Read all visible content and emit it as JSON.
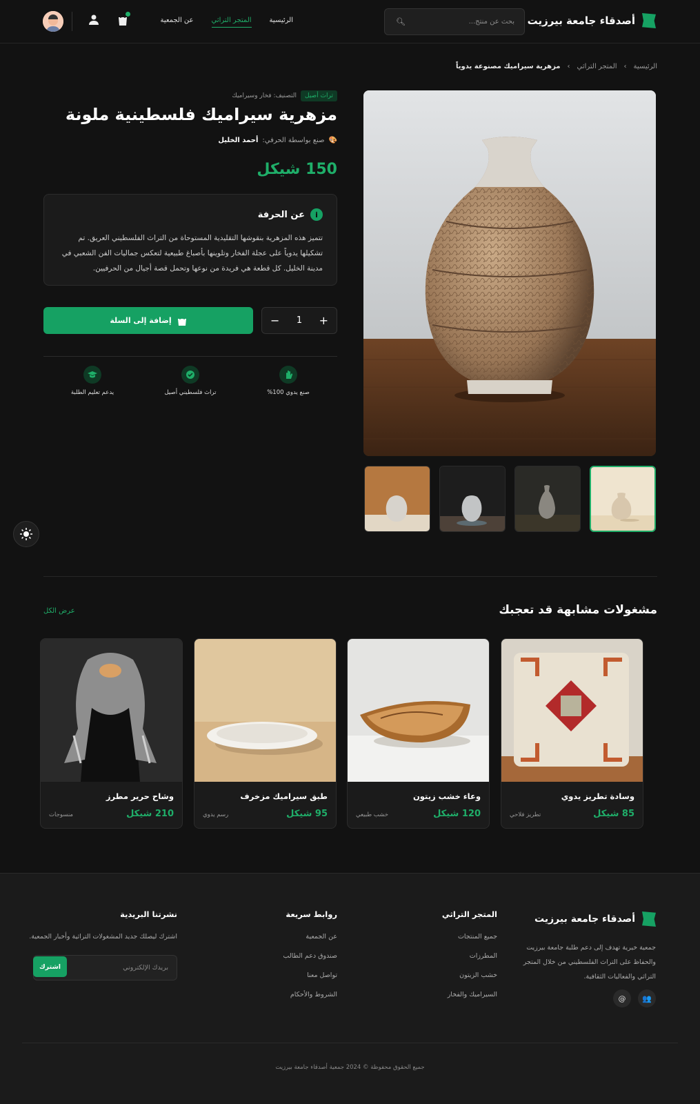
{
  "header": {
    "brand": "أصدقاء جامعة بيرزيت",
    "search_placeholder": "بحث عن منتج...",
    "nav": [
      "الرئيسية",
      "المتجر التراثي",
      "عن الجمعية"
    ]
  },
  "breadcrumb": [
    "الرئيسية",
    "المتجر التراثي",
    "مزهرية سيراميك مصنوعة يدوياً"
  ],
  "breadcrumb_sep": "›",
  "product": {
    "tag": "تراث أصيل",
    "category": "التصنيف: فخار وسيراميك",
    "title": "مزهرية سيراميك فلسطينية ملونة",
    "artisan_label": "صنع بواسطة الحرفي:",
    "artisan_name": "أحمد الخليل",
    "price": "150 شيكل",
    "about_title": "عن الحرفة",
    "about_text": "تتميز هذه المزهرية بنقوشها التقليدية المستوحاة من التراث الفلسطيني العريق. تم تشكيلها يدوياً على عجلة الفخار وتلوينها بأصباغ طبيعية لتعكس جماليات الفن الشعبي في مدينة الخليل. كل قطعة هي فريدة من نوعها وتحمل قصة أجيال من الحرفيين.",
    "quantity": "1",
    "add_to_cart": "إضافة إلى السلة",
    "features": [
      "صنع يدوي 100%",
      "تراث فلسطيني أصيل",
      "يدعم تعليم الطلبة"
    ]
  },
  "related": {
    "title": "مشغولات مشابهة قد تعجبك",
    "view_all": "عرض الكل",
    "items": [
      {
        "title": "وسادة تطريز يدوي",
        "price": "85 شيكل",
        "category": "تطريز فلاحي"
      },
      {
        "title": "وعاء خشب زيتون",
        "price": "120 شيكل",
        "category": "خشب طبيعي"
      },
      {
        "title": "طبق سيراميك مزخرف",
        "price": "95 شيكل",
        "category": "رسم يدوي"
      },
      {
        "title": "وشاح حرير مطرز",
        "price": "210 شيكل",
        "category": "منسوجات"
      }
    ]
  },
  "footer": {
    "brand": "أصدقاء جامعة بيرزيت",
    "description": "جمعية خيرية تهدف إلى دعم طلبة جامعة بيرزيت والحفاظ على التراث الفلسطيني من خلال المتجر التراثي والفعاليات الثقافية.",
    "shop_title": "المتجر التراثي",
    "shop_links": [
      "جميع المنتجات",
      "المطرزات",
      "خشب الزيتون",
      "السيراميك والفخار"
    ],
    "quick_title": "روابط سريعة",
    "quick_links": [
      "عن الجمعية",
      "صندوق دعم الطالب",
      "تواصل معنا",
      "الشروط والأحكام"
    ],
    "newsletter_title": "نشرتنا البريدية",
    "newsletter_desc": "اشترك ليصلك جديد المشغولات التراثية وأخبار الجمعية.",
    "email_placeholder": "بريدك الإلكتروني",
    "subscribe": "اشترك",
    "copyright": "جميع الحقوق محفوظة © 2024 جمعية أصدقاء جامعة بيرزيت"
  }
}
